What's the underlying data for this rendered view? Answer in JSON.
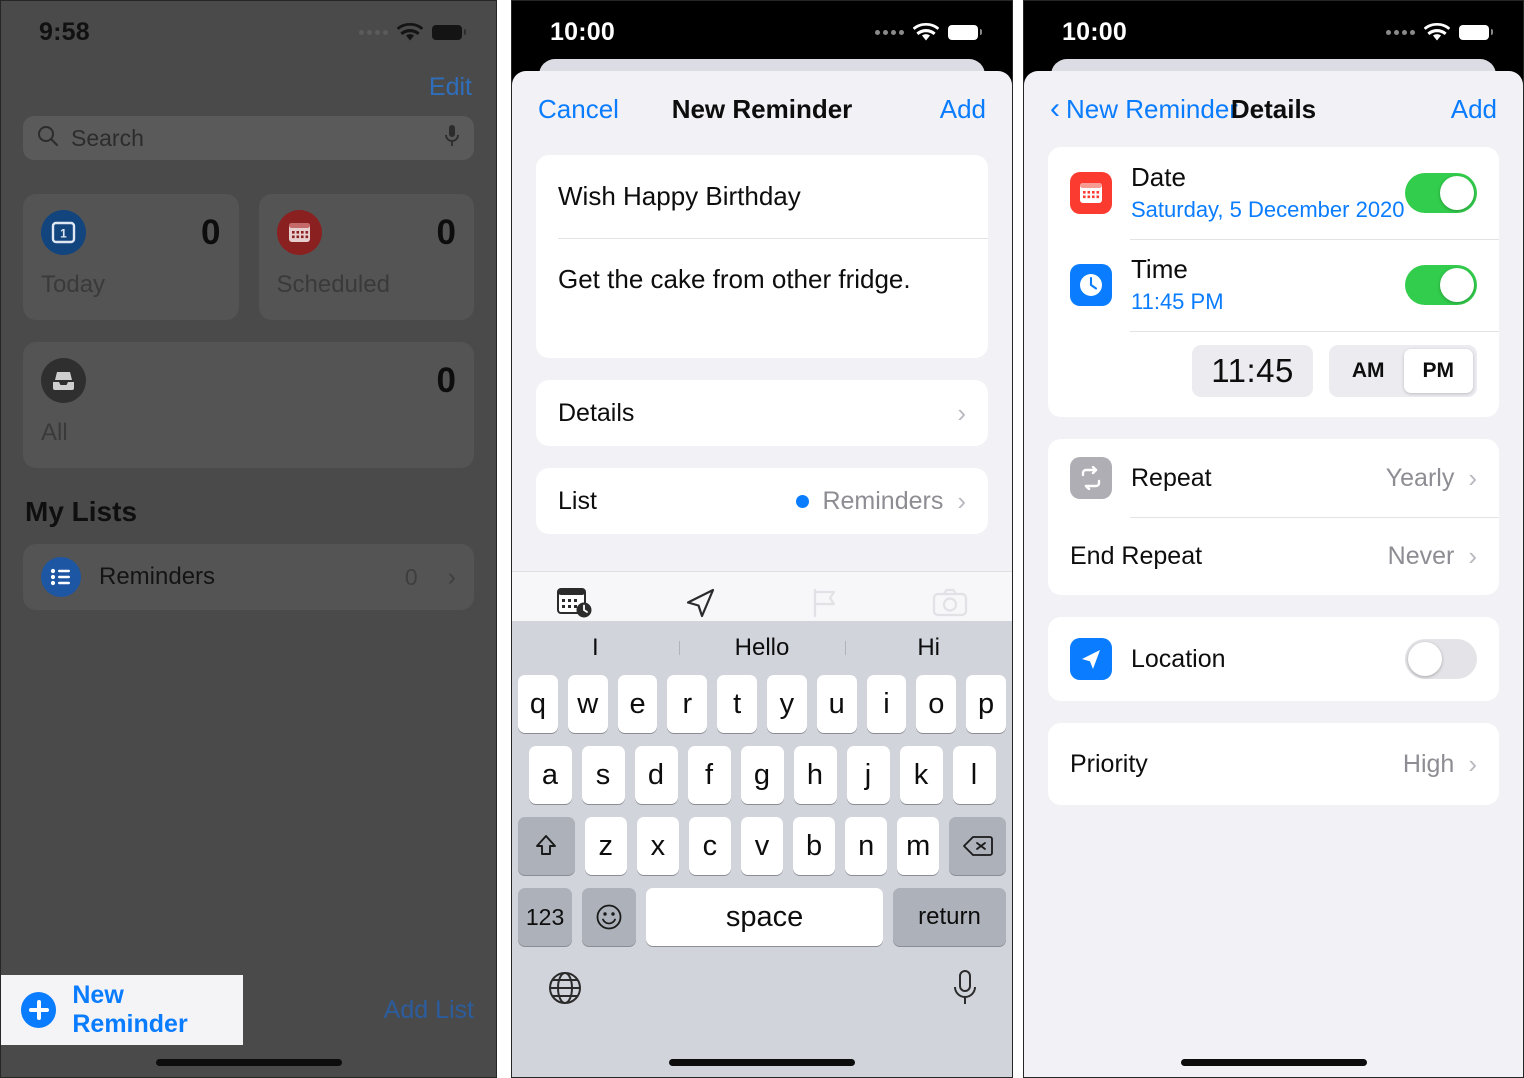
{
  "panel1": {
    "status": {
      "time": "9:58",
      "wifi_icon": "wifi-icon",
      "battery_icon": "battery-icon"
    },
    "edit_label": "Edit",
    "search": {
      "placeholder": "Search",
      "search_icon": "search-icon",
      "mic_icon": "microphone-icon"
    },
    "smart_lists": [
      {
        "name": "Today",
        "count": "0",
        "icon": "today-calendar-icon",
        "color": "#12447e"
      },
      {
        "name": "Scheduled",
        "count": "0",
        "icon": "scheduled-calendar-icon",
        "color": "#8a2020"
      },
      {
        "name": "All",
        "count": "0",
        "icon": "all-inbox-icon",
        "color": "#2f2f2f"
      }
    ],
    "my_lists_header": "My Lists",
    "lists": [
      {
        "name": "Reminders",
        "count": "0",
        "icon": "list-bullets-icon"
      }
    ],
    "bottom": {
      "new_reminder_label": "New Reminder",
      "plus_icon": "plus-circle-icon",
      "add_list_label": "Add List"
    }
  },
  "panel2": {
    "status": {
      "time": "10:00"
    },
    "nav": {
      "cancel": "Cancel",
      "title": "New Reminder",
      "add": "Add"
    },
    "fields": {
      "title_value": "Wish Happy Birthday",
      "notes_value": "Get the cake from other fridge."
    },
    "details_row": {
      "label": "Details",
      "chevron": "chevron-right-icon"
    },
    "list_row": {
      "label": "List",
      "value": "Reminders",
      "dot_color": "#0a7cff",
      "chevron": "chevron-right-icon"
    },
    "toolbar_icons": [
      "calendar-clock-icon",
      "location-arrow-icon",
      "flag-icon",
      "camera-icon"
    ],
    "keyboard": {
      "suggestions": [
        "I",
        "Hello",
        "Hi"
      ],
      "row1": [
        "q",
        "w",
        "e",
        "r",
        "t",
        "y",
        "u",
        "i",
        "o",
        "p"
      ],
      "row2": [
        "a",
        "s",
        "d",
        "f",
        "g",
        "h",
        "j",
        "k",
        "l"
      ],
      "row3": [
        "z",
        "x",
        "c",
        "v",
        "b",
        "n",
        "m"
      ],
      "shift_icon": "shift-icon",
      "backspace_icon": "backspace-icon",
      "numbers_label": "123",
      "emoji_icon": "emoji-icon",
      "space_label": "space",
      "return_label": "return",
      "globe_icon": "globe-icon",
      "mic_icon": "microphone-icon"
    }
  },
  "panel3": {
    "status": {
      "time": "10:00"
    },
    "nav": {
      "back": "New Reminder",
      "title": "Details",
      "add": "Add",
      "back_icon": "chevron-left-icon"
    },
    "date_row": {
      "label": "Date",
      "value": "Saturday, 5 December 2020",
      "icon": "calendar-icon",
      "icon_color": "#fc3b30",
      "toggle": "on"
    },
    "time_row": {
      "label": "Time",
      "value": "11:45 PM",
      "icon": "clock-icon",
      "icon_color": "#0a7cff",
      "toggle": "on"
    },
    "time_picker": {
      "time": "11:45",
      "am_label": "AM",
      "pm_label": "PM",
      "selected": "PM"
    },
    "repeat_row": {
      "label": "Repeat",
      "value": "Yearly",
      "icon": "repeat-icon",
      "icon_color": "#aeaeb4"
    },
    "end_repeat_row": {
      "label": "End Repeat",
      "value": "Never"
    },
    "location_row": {
      "label": "Location",
      "icon": "location-arrow-icon",
      "icon_color": "#0a7cff",
      "toggle": "off"
    },
    "priority_row": {
      "label": "Priority",
      "value": "High"
    },
    "toggle_on_color": "#32cd4c",
    "toggle_off_color": "#e4e4e8"
  }
}
